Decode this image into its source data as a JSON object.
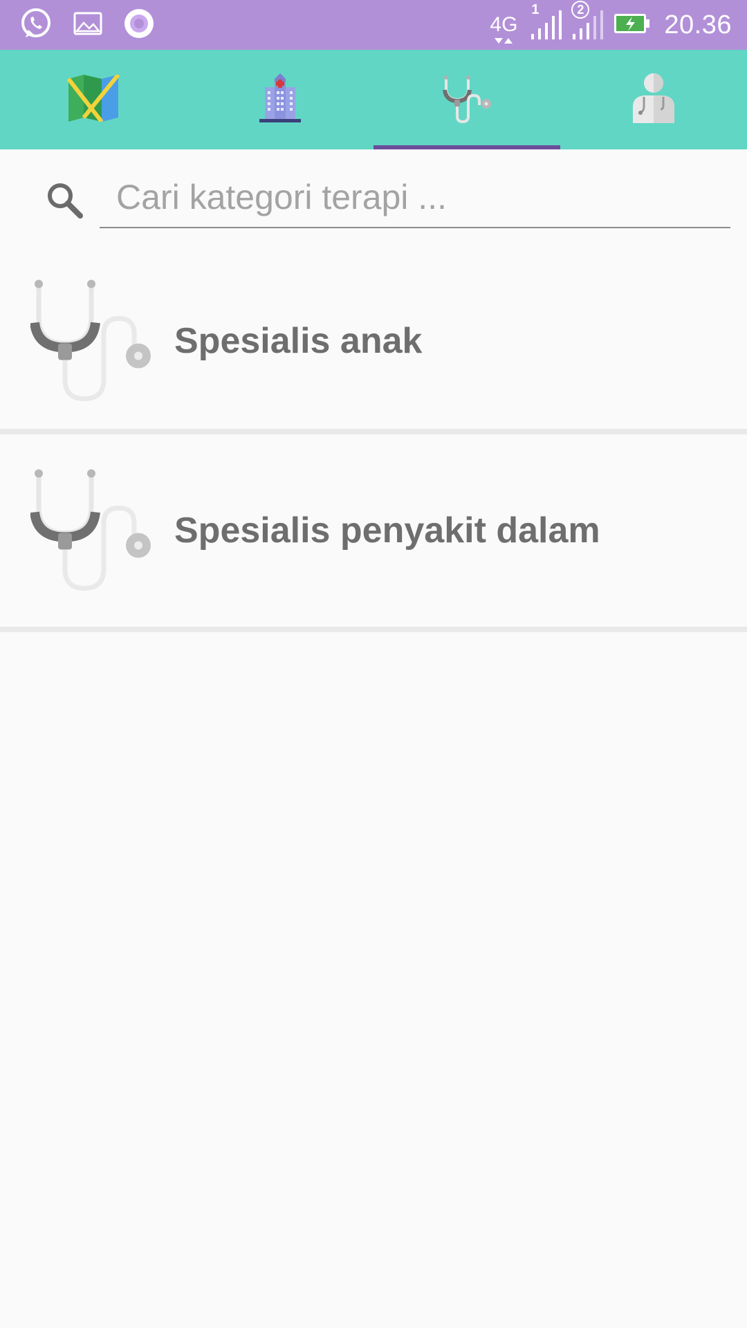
{
  "status_bar": {
    "network": "4G",
    "sim1": "1",
    "sim2": "2",
    "time": "20.36",
    "icons": [
      "whatsapp-icon",
      "image-icon",
      "record-icon",
      "network-4g-icon",
      "signal-sim1-icon",
      "signal-sim2-icon",
      "battery-charging-icon"
    ]
  },
  "tabs": [
    {
      "name": "tab-map",
      "icon": "map-icon",
      "selected": false
    },
    {
      "name": "tab-hospital",
      "icon": "hospital-icon",
      "selected": false
    },
    {
      "name": "tab-therapy",
      "icon": "stethoscope-icon",
      "selected": true
    },
    {
      "name": "tab-doctor",
      "icon": "doctor-icon",
      "selected": false
    }
  ],
  "search": {
    "placeholder": "Cari kategori terapi ...",
    "value": ""
  },
  "categories": [
    {
      "label": "Spesialis anak",
      "icon": "stethoscope-icon"
    },
    {
      "label": "Spesialis penyakit dalam",
      "icon": "stethoscope-icon"
    }
  ],
  "colors": {
    "status_bar": "#b290d8",
    "tab_bar": "#62d6c4",
    "tab_indicator": "#6a4e9a",
    "background": "#fafafa",
    "divider": "#e9e9e9",
    "label_text": "#6e6e6e"
  }
}
